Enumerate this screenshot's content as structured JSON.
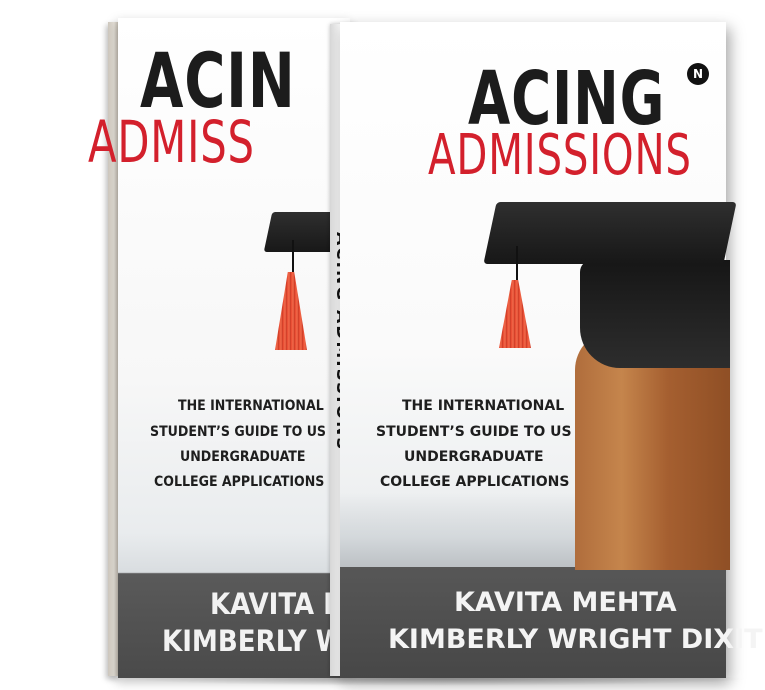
{
  "back_cover": {
    "title_line1": "ACIN",
    "title_line2": "ADMISS",
    "subtitle": [
      "THE INTERNATIONAL",
      "STUDENT’S GUIDE TO US",
      "UNDERGRADUATE",
      "COLLEGE APPLICATIONS"
    ],
    "authors": [
      "KAVITA M",
      "KIMBERLY WRI"
    ]
  },
  "spine": {
    "text": "ACING ADMISSIONS"
  },
  "front_cover": {
    "publisher_logo": "N",
    "title_line1": "ACING",
    "title_line2": "ADMISSIONS",
    "subtitle": [
      "THE INTERNATIONAL",
      "STUDENT’S GUIDE TO US",
      "UNDERGRADUATE",
      "COLLEGE APPLICATIONS"
    ],
    "authors": [
      "KAVITA MEHTA",
      "KIMBERLY WRIGHT DIXIT"
    ]
  },
  "colors": {
    "title_black": "#1c1c1c",
    "title_red": "#d3202c",
    "author_band": "#4a4a4a",
    "tassel": "#e8472f"
  }
}
